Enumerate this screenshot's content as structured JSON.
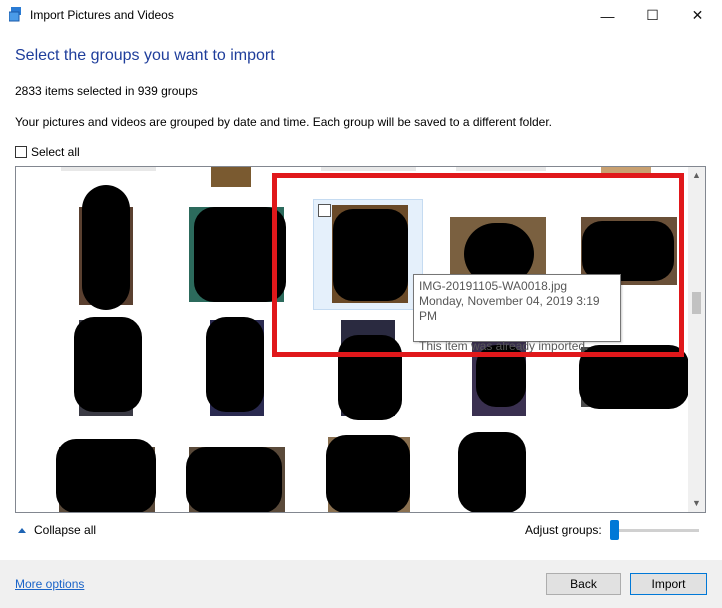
{
  "window": {
    "title": "Import Pictures and Videos",
    "minimize_glyph": "—",
    "maximize_glyph": "☐",
    "close_glyph": "✕",
    "app_icon": "photo-import-icon"
  },
  "heading": "Select the groups you want to import",
  "selection_summary": "2833 items selected in 939 groups",
  "description": "Your pictures and videos are grouped by date and time. Each group will be saved to a different folder.",
  "select_all_label": "Select all",
  "tooltip": {
    "filename": "IMG-20191105-WA0018.jpg",
    "date": "Monday, November 04, 2019 3:19 PM",
    "status": "This item was already imported."
  },
  "collapse_all_label": "Collapse all",
  "adjust_groups_label": "Adjust groups:",
  "more_options_label": "More options",
  "back_label": "Back",
  "import_label": "Import",
  "colors": {
    "heading": "#1f3e9b",
    "link": "#1a64c8",
    "annotation_red": "#e0181b",
    "slider_accent": "#0078d7"
  }
}
